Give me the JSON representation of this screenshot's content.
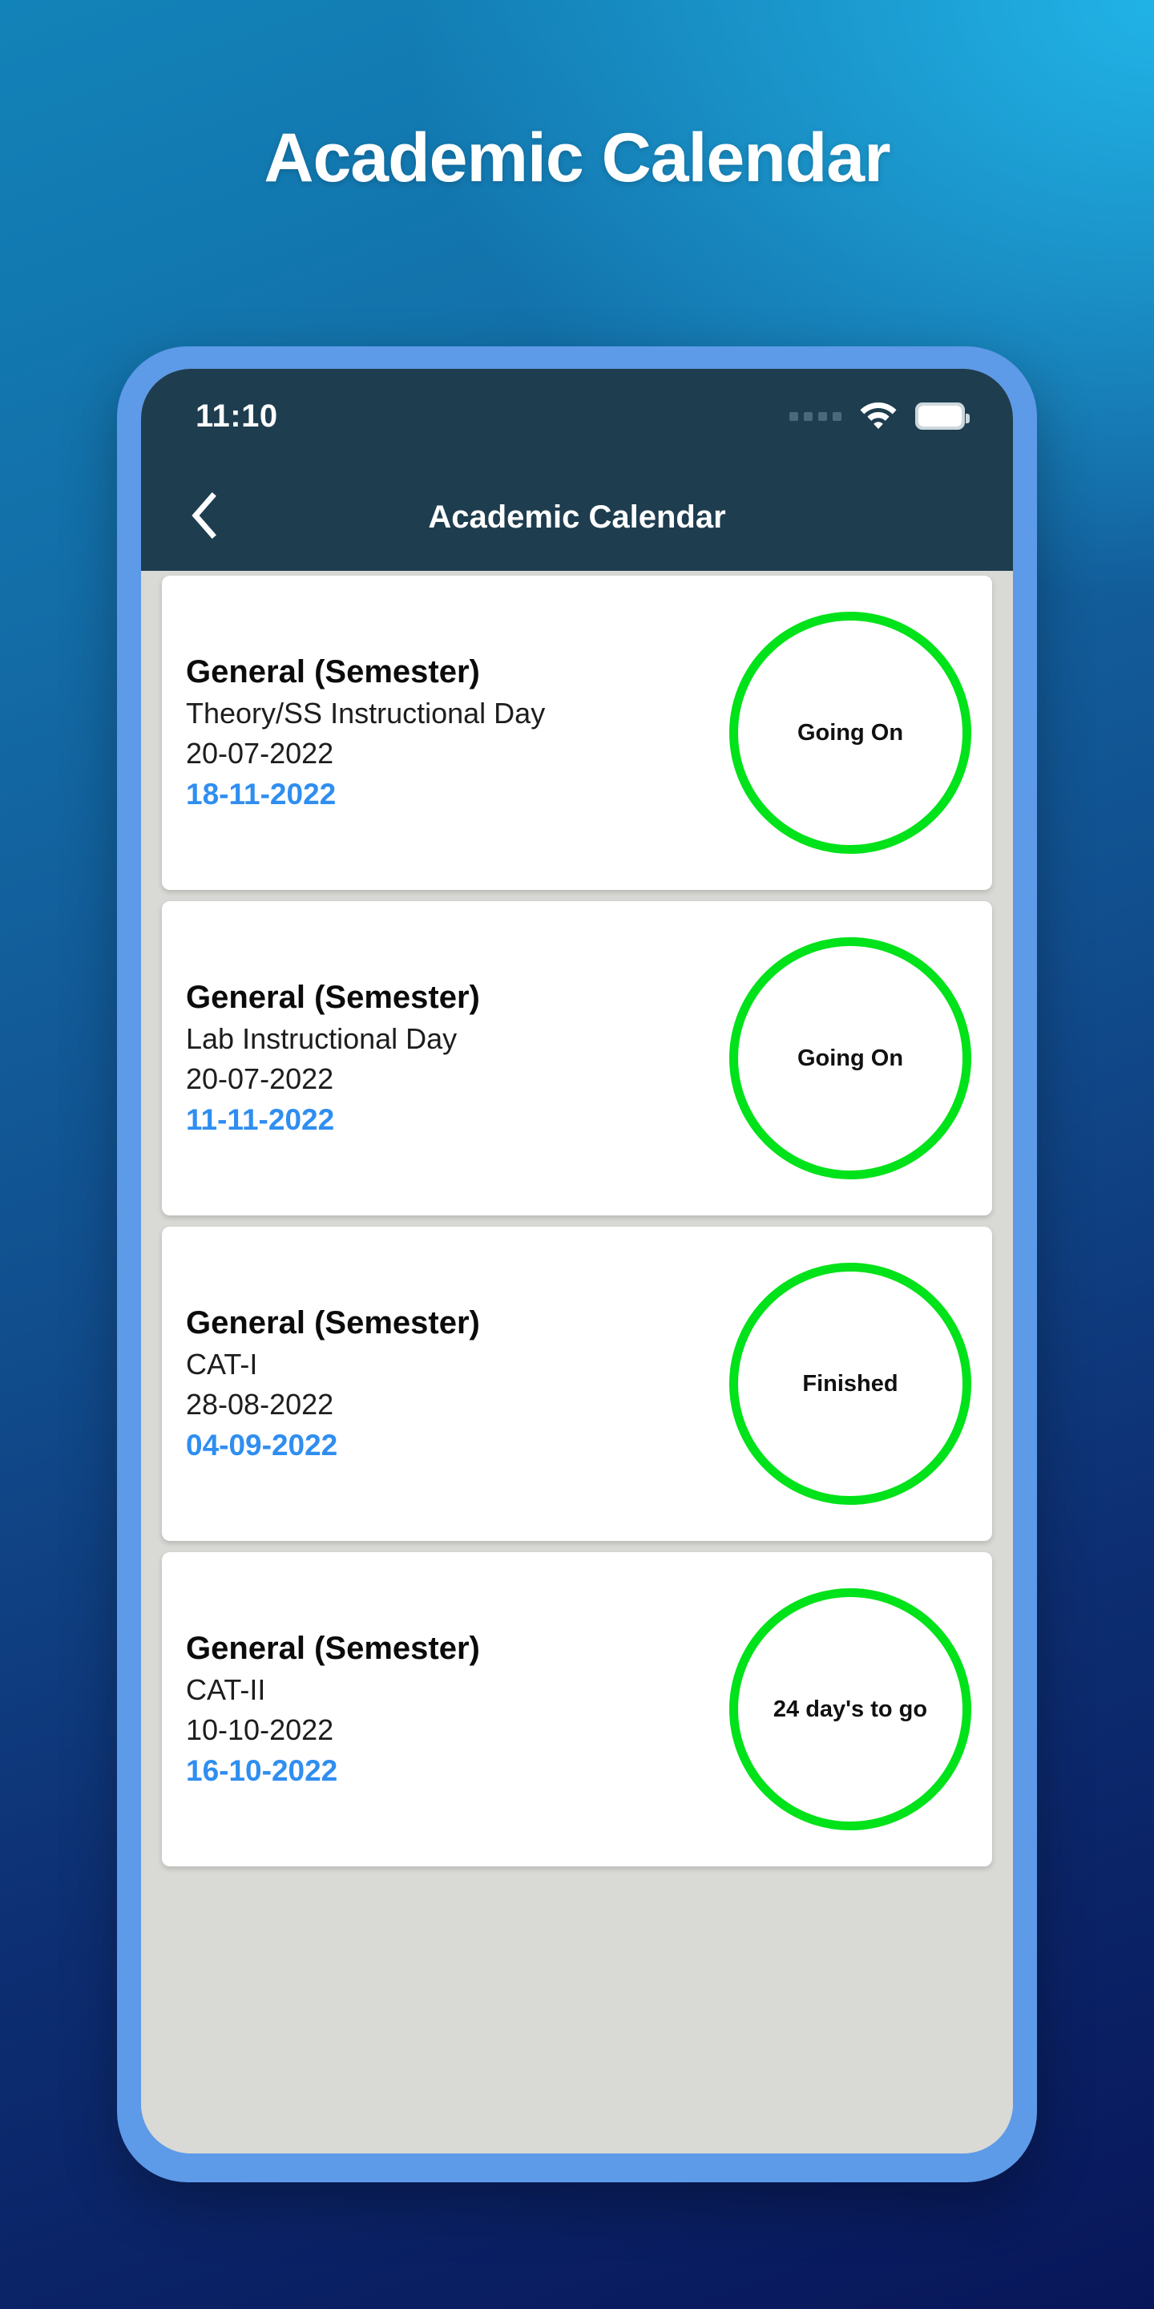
{
  "page": {
    "heading": "Academic Calendar"
  },
  "phone": {
    "status_bar": {
      "time": "11:10",
      "signal_icon": "signal-dots-icon",
      "wifi_icon": "wifi-icon",
      "battery_icon": "battery-full-icon"
    },
    "nav_bar": {
      "back_icon": "chevron-left-icon",
      "title": "Academic Calendar"
    },
    "events": [
      {
        "title": "General (Semester)",
        "subtitle": "Theory/SS Instructional Day",
        "start_date": "20-07-2022",
        "end_date": "18-11-2022",
        "status": "Going On"
      },
      {
        "title": "General (Semester)",
        "subtitle": "Lab Instructional Day",
        "start_date": "20-07-2022",
        "end_date": "11-11-2022",
        "status": "Going On"
      },
      {
        "title": "General (Semester)",
        "subtitle": "CAT-I",
        "start_date": "28-08-2022",
        "end_date": "04-09-2022",
        "status": "Finished"
      },
      {
        "title": "General (Semester)",
        "subtitle": "CAT-II",
        "start_date": "10-10-2022",
        "end_date": "16-10-2022",
        "status": "24 day's to go"
      }
    ]
  },
  "colors": {
    "background_top_right": "#21b3e6",
    "background_bottom_left": "#081659",
    "phone_frame": "#5d9ae8",
    "status_bar": "#1e3d4f",
    "app_background": "#d9d9d6",
    "card": "#ffffff",
    "end_date_accent": "#2f8ef0",
    "badge_ring": "#00e219"
  }
}
